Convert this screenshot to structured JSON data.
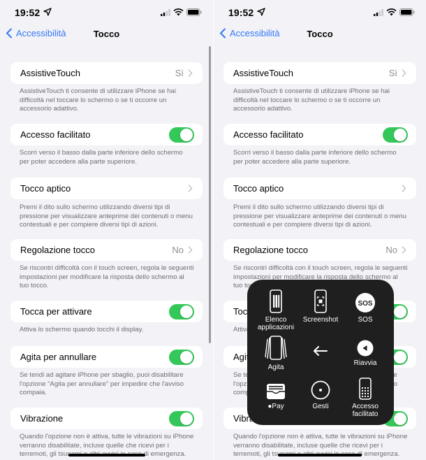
{
  "status_bar": {
    "time": "19:52",
    "icons": [
      "location-arrow-icon",
      "cellular-signal-icon",
      "wifi-icon",
      "battery-icon"
    ]
  },
  "nav": {
    "back_label": "Accessibilità",
    "title": "Tocco"
  },
  "colors": {
    "accent": "#3478f6",
    "toggle_on": "#34c759",
    "background": "#f2f2f7",
    "menu_bg": "#1f1f1f"
  },
  "settings": [
    {
      "label": "AssistiveTouch",
      "value": "Sì",
      "type": "disclosure",
      "footer": "AssistiveTouch ti consente di utilizzare iPhone se hai difficoltà nel toccare lo schermo o se ti occorre un accessorio adattivo."
    },
    {
      "label": "Accesso facilitato",
      "type": "toggle",
      "on": true,
      "footer": "Scorri verso il basso dalla parte inferiore dello schermo per poter accedere alla parte superiore."
    },
    {
      "label": "Tocco aptico",
      "value": "",
      "type": "disclosure",
      "footer": "Premi il dito sullo schermo utilizzando diversi tipi di pressione per visualizzare anteprime dei contenuti o menu contestuali e per compiere diversi tipi di azioni."
    },
    {
      "label": "Regolazione tocco",
      "value": "No",
      "type": "disclosure",
      "footer": "Se riscontri difficoltà con il touch screen, regola le seguenti impostazioni per modificare la risposta dello schermo al tuo tocco."
    },
    {
      "label": "Tocca per attivare",
      "type": "toggle",
      "on": true,
      "footer": "Attiva lo schermo quando tocchi il display."
    },
    {
      "label": "Agita per annullare",
      "type": "toggle",
      "on": true,
      "footer": "Se tendi ad agitare iPhone per sbaglio, puoi disabilitare l'opzione “Agita per annullare” per impedire che l'avviso compaia."
    },
    {
      "label": "Vibrazione",
      "type": "toggle",
      "on": true,
      "footer": "Quando l'opzione non è attiva, tutte le vibrazioni su iPhone verranno disabilitate, incluse quelle che ricevi per i terremoti, gli tsunami e altri avvisi in caso di emergenza."
    }
  ],
  "assistive_menu": {
    "items": [
      {
        "label": "Elenco applicazioni",
        "icon": "app-switcher-icon"
      },
      {
        "label": "Screenshot",
        "icon": "screenshot-icon"
      },
      {
        "label": "SOS",
        "icon": "sos-icon",
        "icon_text": "SOS"
      },
      {
        "label": "Agita",
        "icon": "shake-icon"
      },
      {
        "label": "",
        "icon": "back-arrow-icon"
      },
      {
        "label": "Riavvia",
        "icon": "restart-icon"
      },
      {
        "label": "Pay",
        "display_label": "Pay",
        "icon": "wallet-icon"
      },
      {
        "label": "Gesti",
        "icon": "gestures-icon"
      },
      {
        "label": "Accesso facilitato",
        "icon": "reachability-icon"
      }
    ]
  }
}
